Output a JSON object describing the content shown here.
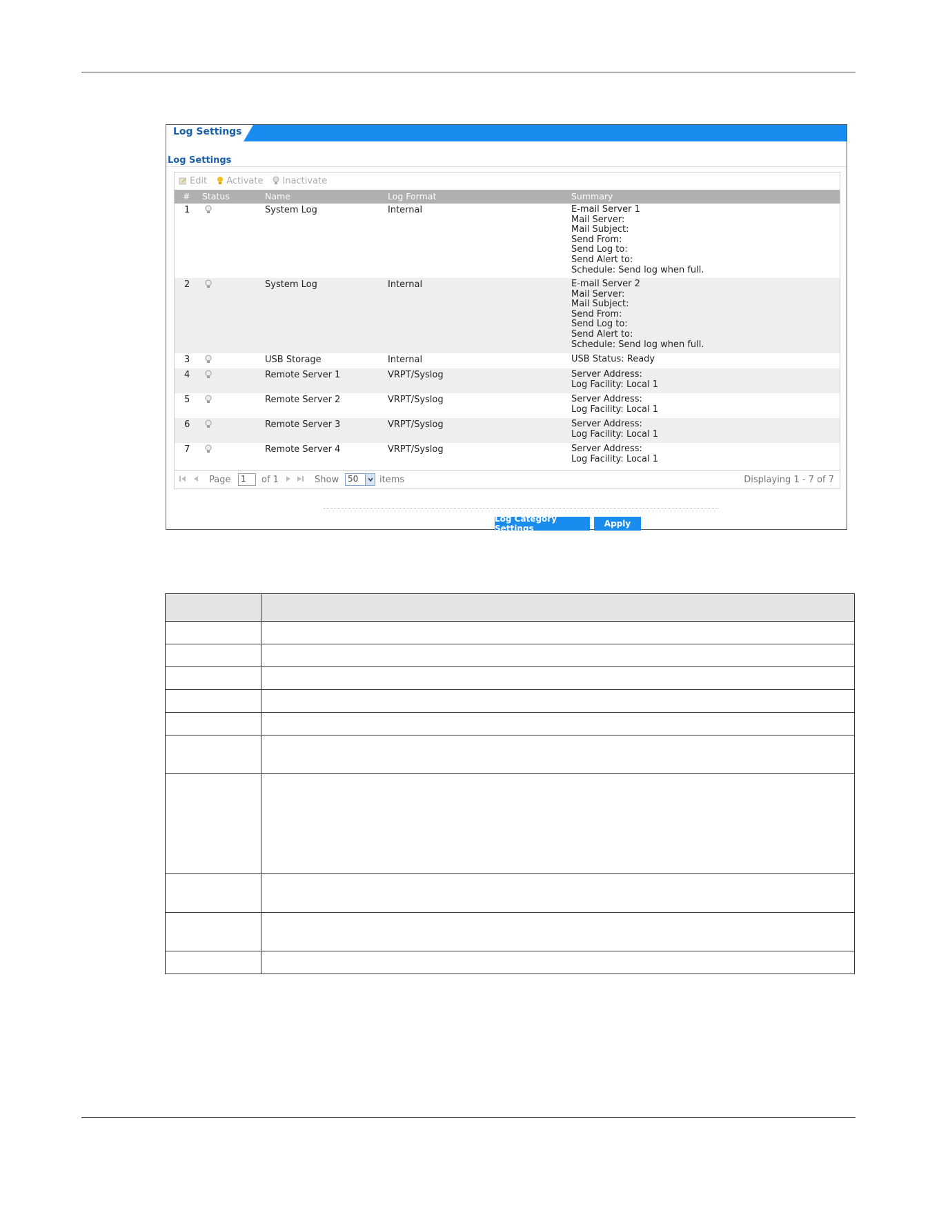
{
  "tab": {
    "label": "Log Settings"
  },
  "section": {
    "title": "Log Settings"
  },
  "toolbar": {
    "edit": "Edit",
    "activate": "Activate",
    "inactivate": "Inactivate"
  },
  "columns": {
    "num": "#",
    "status": "Status",
    "name": "Name",
    "format": "Log Format",
    "summary": "Summary"
  },
  "rows": [
    {
      "num": "1",
      "name": "System Log",
      "format": "Internal",
      "summary": [
        "E-mail Server 1",
        "Mail Server:",
        "Mail Subject:",
        "Send From:",
        "Send Log to:",
        "Send Alert to:",
        "Schedule: Send log when full."
      ]
    },
    {
      "num": "2",
      "name": "System Log",
      "format": "Internal",
      "summary": [
        "E-mail Server 2",
        "Mail Server:",
        "Mail Subject:",
        "Send From:",
        "Send Log to:",
        "Send Alert to:",
        "Schedule: Send log when full."
      ]
    },
    {
      "num": "3",
      "name": "USB Storage",
      "format": "Internal",
      "summary": [
        "USB Status: Ready"
      ]
    },
    {
      "num": "4",
      "name": "Remote Server 1",
      "format": "VRPT/Syslog",
      "summary": [
        "Server Address:",
        "Log Facility: Local 1"
      ]
    },
    {
      "num": "5",
      "name": "Remote Server 2",
      "format": "VRPT/Syslog",
      "summary": [
        "Server Address:",
        "Log Facility: Local 1"
      ]
    },
    {
      "num": "6",
      "name": "Remote Server 3",
      "format": "VRPT/Syslog",
      "summary": [
        "Server Address:",
        "Log Facility: Local 1"
      ]
    },
    {
      "num": "7",
      "name": "Remote Server 4",
      "format": "VRPT/Syslog",
      "summary": [
        "Server Address:",
        "Log Facility: Local 1"
      ]
    }
  ],
  "pager": {
    "page_label": "Page",
    "page_value": "1",
    "of_label": "of 1",
    "show_label": "Show",
    "show_value": "50",
    "items_label": "items",
    "displaying": "Displaying 1 - 7 of 7"
  },
  "buttons": {
    "category": "Log Category Settings",
    "apply": "Apply"
  },
  "colors": {
    "accent": "#1a8cf0",
    "title_blue": "#1a5faa",
    "header_gray": "#b0b0b0"
  }
}
